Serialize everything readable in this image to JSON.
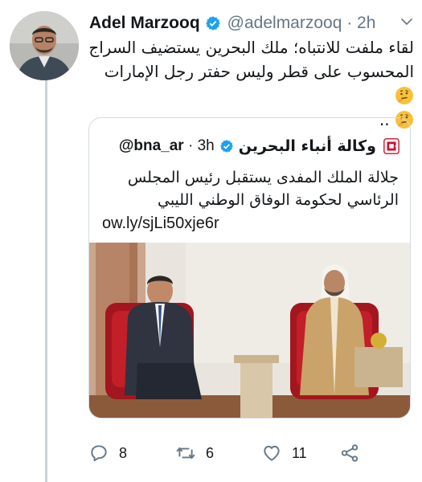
{
  "tweet": {
    "author_name": "Adel Marzooq",
    "handle_time": "@adelmarzooq · 2h",
    "text_line1": "لقاء ملفت للانتباه؛ ملك البحرين يستضيف السراج",
    "text_line2": "المحسوب على قطر وليس حفتر رجل الإمارات",
    "text_line3": "..",
    "emoji": "thinking-face"
  },
  "quote": {
    "author_name": "وكالة أنباء البحرين",
    "handle": "@bna_ar",
    "time": " · 3h",
    "text": "جلالة الملك المفدى يستقبل رئيس المجلس الرئاسي لحكومة الوفاق الوطني الليبي",
    "link": "ow.ly/sjLi50xje6r"
  },
  "actions": {
    "reply_count": "8",
    "retweet_count": "6",
    "like_count": "11"
  },
  "colors": {
    "verified": "#1da1f2",
    "secondary_text": "#657786",
    "border": "#d3dbe2"
  }
}
